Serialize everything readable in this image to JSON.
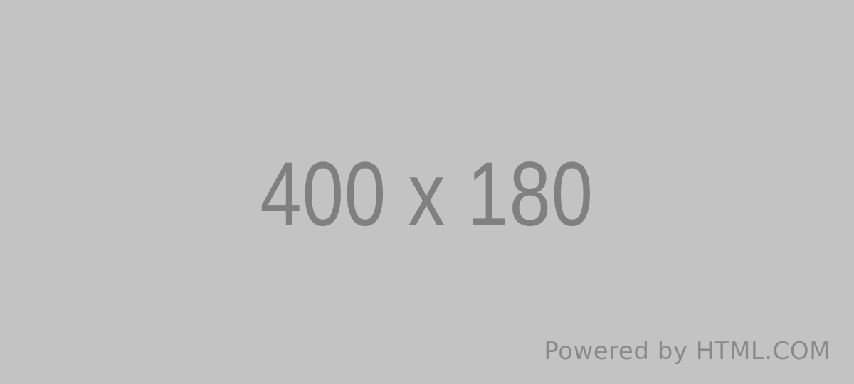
{
  "placeholder": {
    "dimensions_text": "400 x 180",
    "powered_by": "Powered by HTML.COM",
    "background_color": "#c3c3c3",
    "text_color": "#808080"
  }
}
